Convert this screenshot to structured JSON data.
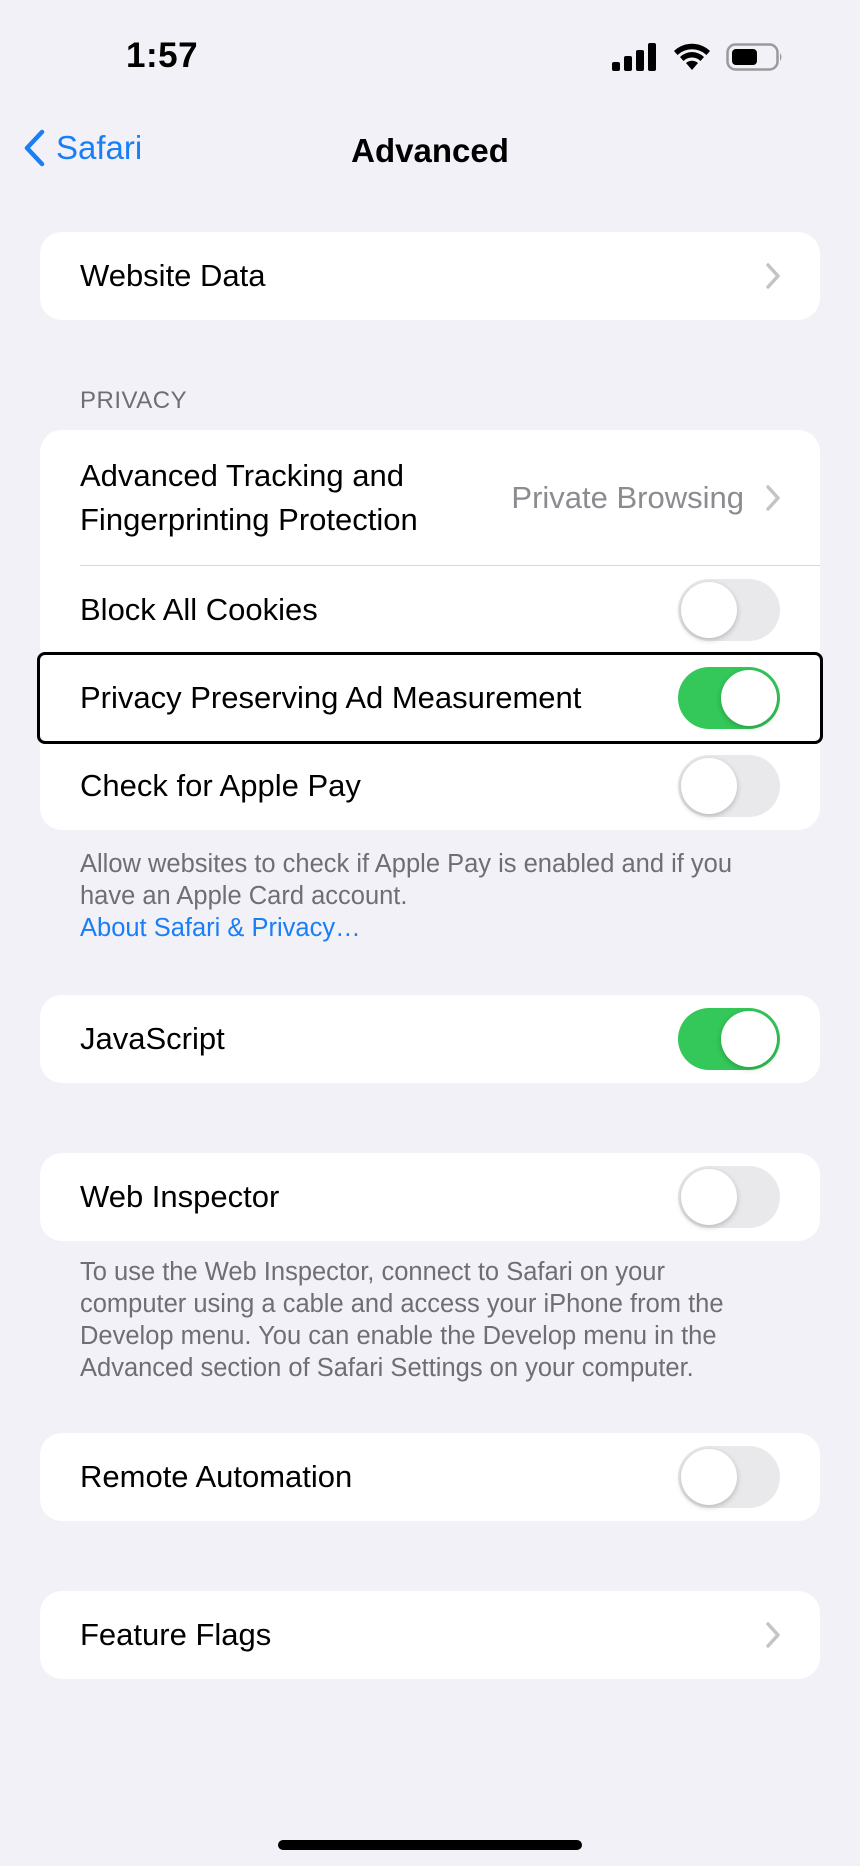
{
  "status_bar": {
    "time": "1:57"
  },
  "nav": {
    "back_label": "Safari",
    "title": "Advanced"
  },
  "website_data": {
    "label": "Website Data"
  },
  "privacy": {
    "header": "PRIVACY",
    "tracking_label_line1": "Advanced Tracking and",
    "tracking_label_line2": "Fingerprinting Protection",
    "tracking_value": "Private Browsing",
    "block_cookies_label": "Block All Cookies",
    "block_cookies_on": false,
    "ad_measurement_label": "Privacy Preserving Ad Measurement",
    "ad_measurement_on": true,
    "apple_pay_label": "Check for Apple Pay",
    "apple_pay_on": false,
    "footer_line1": "Allow websites to check if Apple Pay is enabled and if you",
    "footer_line2": "have an Apple Card account.",
    "footer_link": "About Safari & Privacy…"
  },
  "javascript": {
    "label": "JavaScript",
    "on": true
  },
  "web_inspector": {
    "label": "Web Inspector",
    "on": false,
    "footer_line1": "To use the Web Inspector, connect to Safari on your",
    "footer_line2": "computer using a cable and access your iPhone from the",
    "footer_line3": "Develop menu. You can enable the Develop menu in the",
    "footer_line4": "Advanced section of Safari Settings on your computer."
  },
  "remote_automation": {
    "label": "Remote Automation",
    "on": false
  },
  "feature_flags": {
    "label": "Feature Flags"
  },
  "colors": {
    "accent": "#1a7ff5",
    "toggle_on": "#34c759",
    "toggle_off": "#e9e9eb",
    "background": "#f1f1f7"
  }
}
